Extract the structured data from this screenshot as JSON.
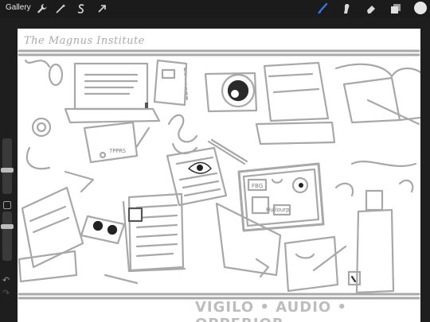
{
  "app": {
    "gallery_label": "Gallery",
    "colors": {
      "brush_active": "#2f7bf6",
      "color_swatch": "#e6e6e6",
      "sketch": "#a8a8a8"
    }
  },
  "toolbar_left": [
    {
      "name": "actions-wrench-icon"
    },
    {
      "name": "adjustments-magic-icon"
    },
    {
      "name": "selection-s-icon"
    },
    {
      "name": "transform-arrow-icon"
    }
  ],
  "toolbar_right": [
    {
      "name": "brush-icon",
      "active": true
    },
    {
      "name": "smudge-icon"
    },
    {
      "name": "eraser-icon"
    },
    {
      "name": "layers-icon"
    },
    {
      "name": "color-swatch"
    }
  ],
  "canvas": {
    "header_text": "The Magnus Institute",
    "footer_text": "VIGILO • AUDIO • OPPERIOR",
    "sketch_labels": {
      "note_small": "7PPRS",
      "board_tag": "FBG",
      "board_note": "Hullourp"
    }
  }
}
